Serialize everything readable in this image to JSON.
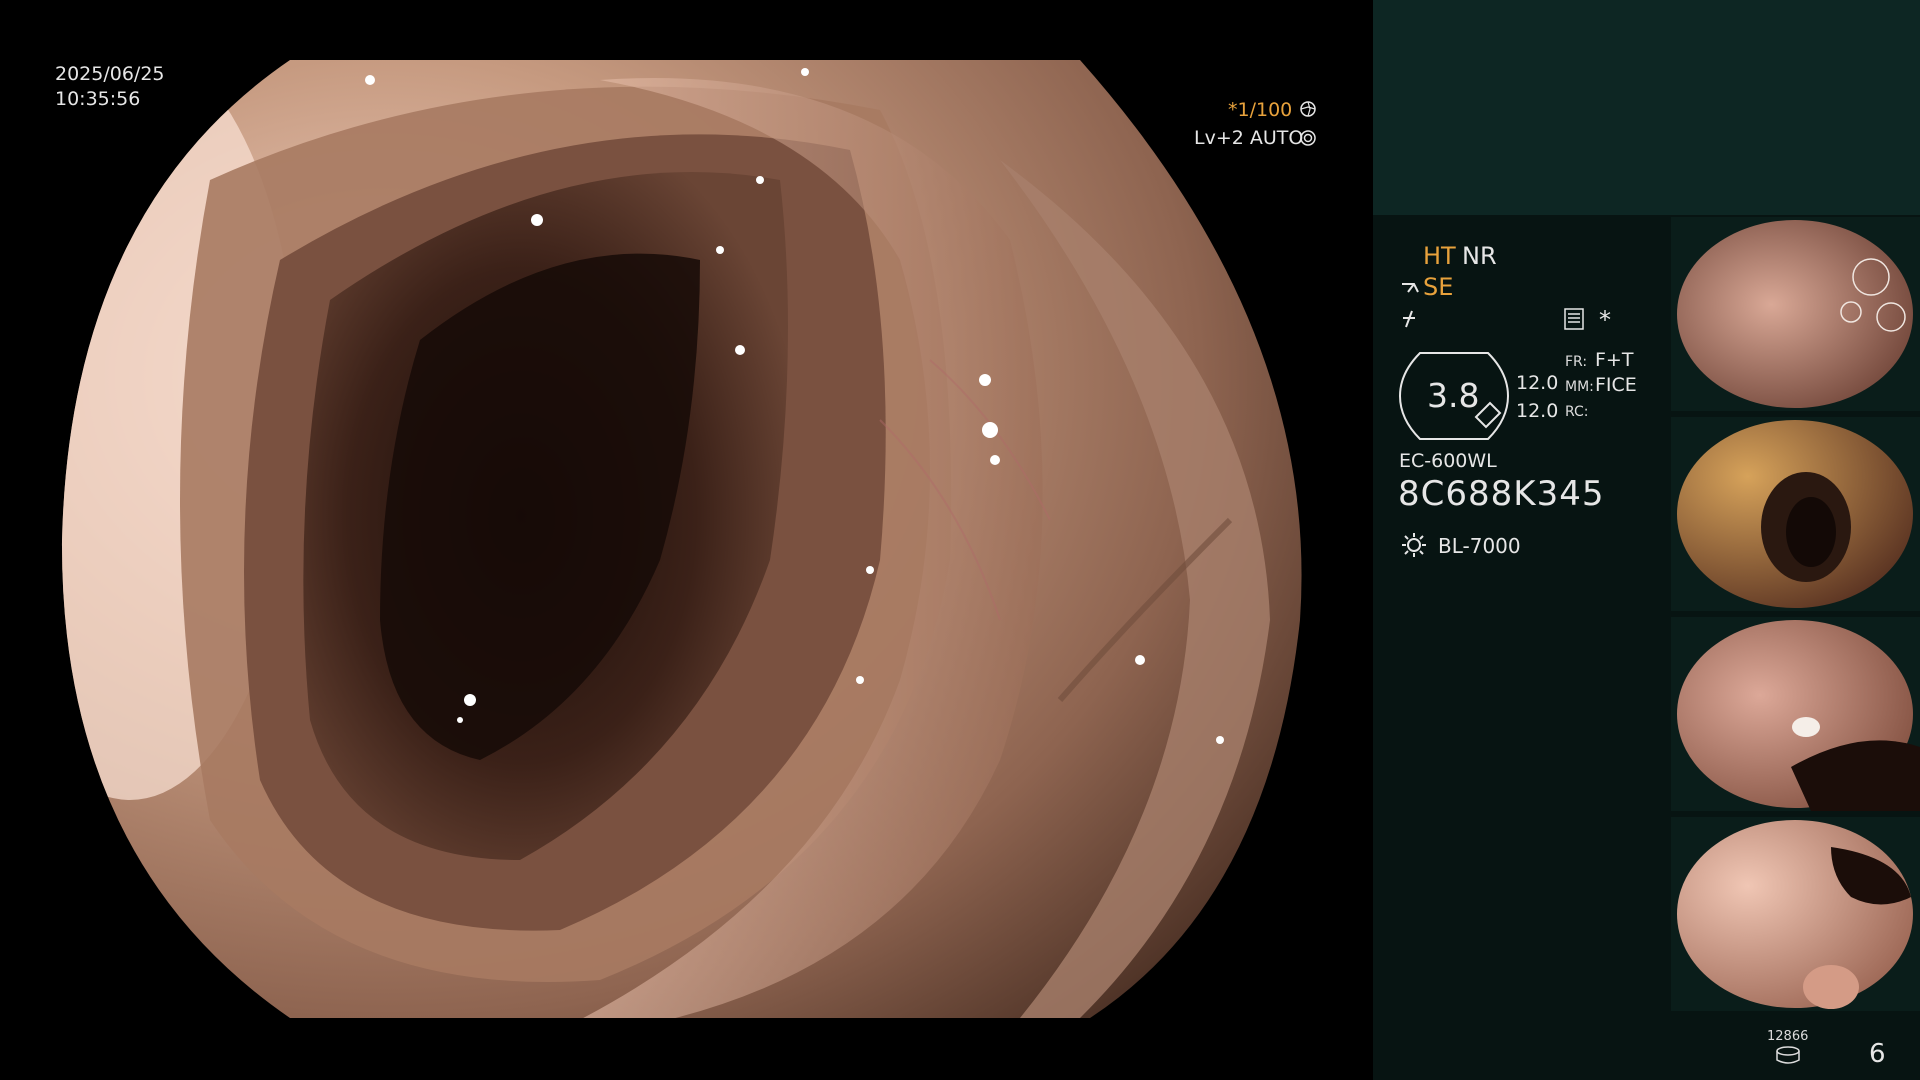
{
  "screen": {
    "date": "2025/06/25",
    "time": "10:35:56",
    "shutter": "*1/100",
    "level_mode": "Lv+2 AUTO"
  },
  "status_panel": {
    "ht": "HT",
    "nr": "NR",
    "se": "SE",
    "star": "*",
    "dial_value": "3.8",
    "value_top": "12.0",
    "value_bottom": "12.0",
    "fr_label": "FR:",
    "fr_value": "F+T",
    "mm_label": "MM:",
    "mm_value": "FICE",
    "rc_label": "RC:",
    "scope_model": "EC-600WL",
    "scope_serial": "8C688K345",
    "light_source": "BL-7000",
    "storage_count": "12866",
    "capture_count": "6"
  },
  "thumbnails": [
    {
      "name": "capture-1"
    },
    {
      "name": "capture-2"
    },
    {
      "name": "capture-3"
    },
    {
      "name": "capture-4"
    }
  ],
  "colors": {
    "accent_orange": "#e8a23c",
    "panel_bg": "#071412",
    "panel_top_bg": "#0d2623",
    "text": "#e6e6e6"
  }
}
